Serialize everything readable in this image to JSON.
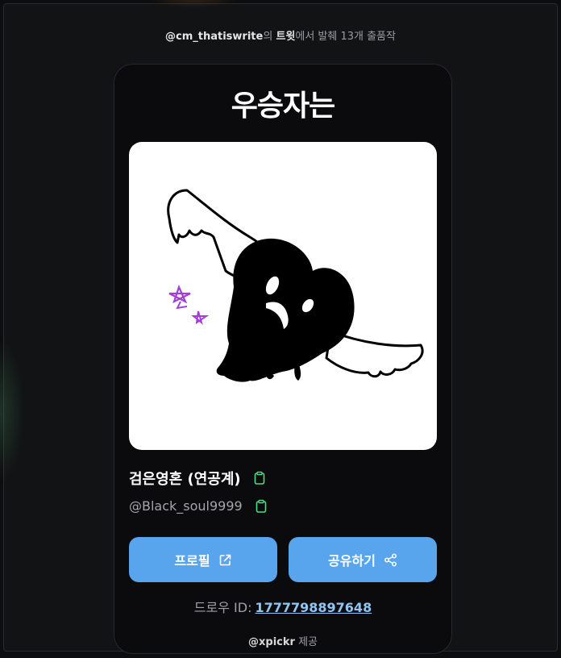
{
  "header": {
    "source_user": "@cm_thatiswrite",
    "source_particle": "의",
    "source_platform": "트윗",
    "source_suffix": "에서 발췌 13개 출품작"
  },
  "card": {
    "title": "우승자는",
    "winner_name": "검은영혼 (연공계)",
    "winner_handle": "@Black_soul9999",
    "profile_button": "프로필",
    "share_button": "공유하기",
    "draw_id_label": "드로우 ID:",
    "draw_id_value": "1777798897648",
    "credit_user": "@xpickr",
    "credit_suffix": "제공"
  },
  "icons": {
    "copy": "clipboard-icon",
    "external": "external-link-icon",
    "share": "share-icon"
  },
  "colors": {
    "accent": "#58a5ee",
    "copy_icon": "#4ade80",
    "link": "#8ec5f5"
  }
}
